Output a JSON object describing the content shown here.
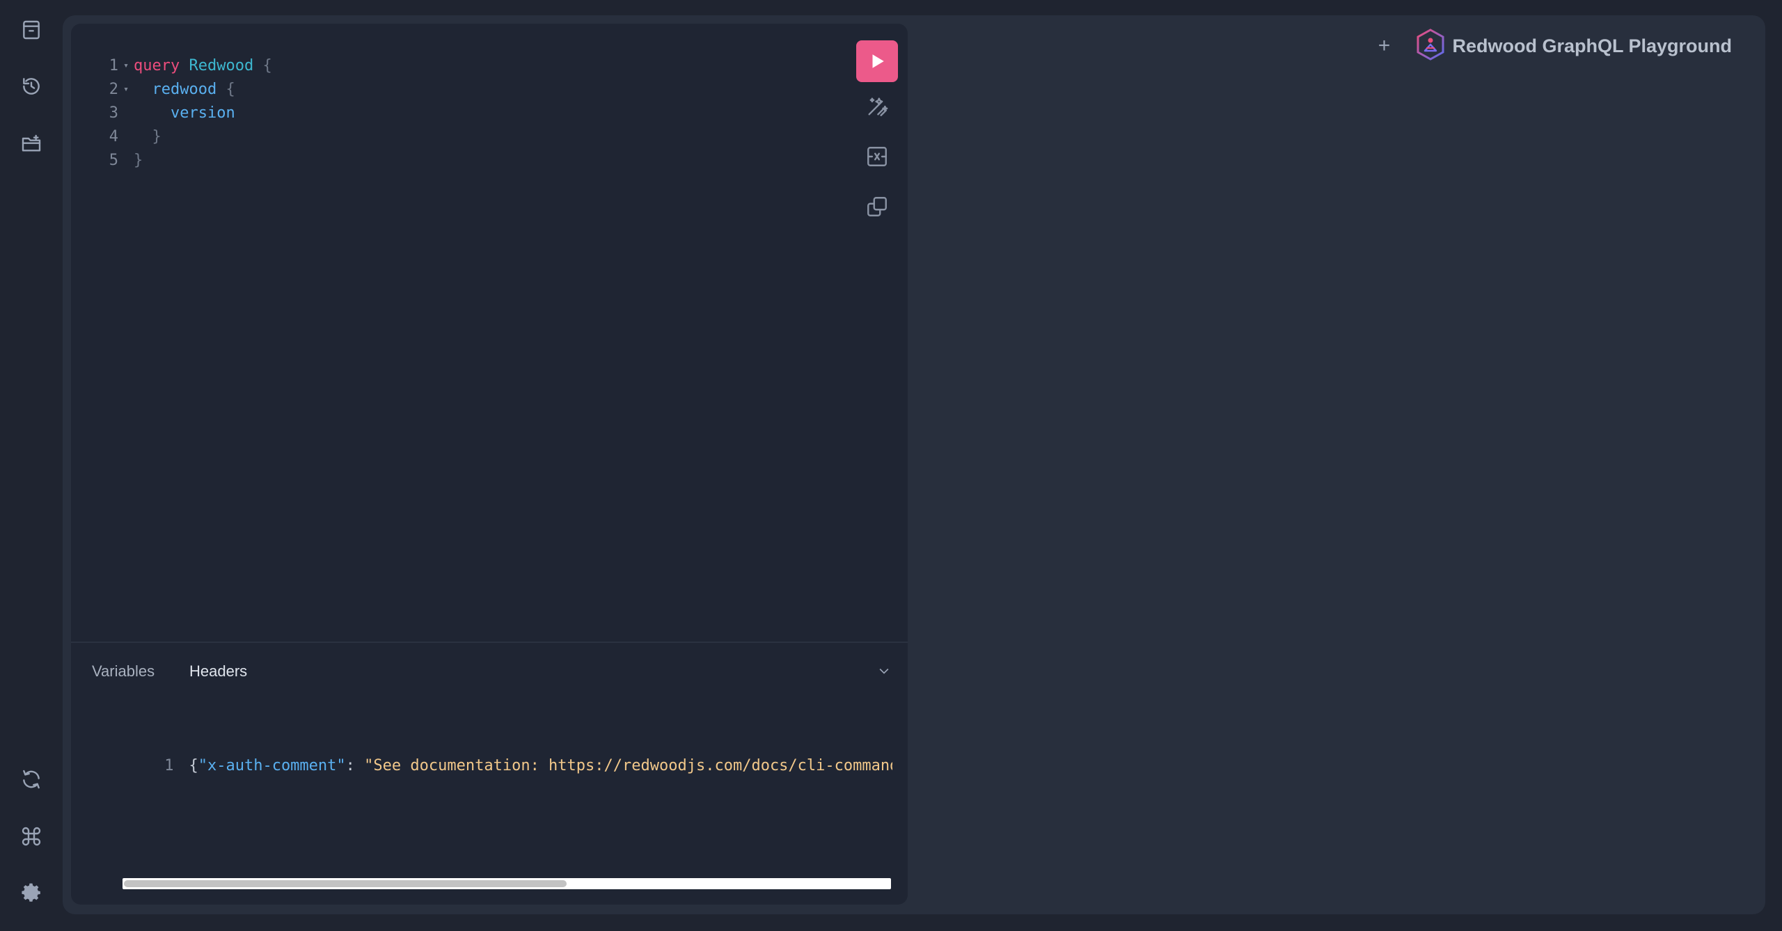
{
  "sidebar": {
    "top_items": [
      {
        "icon": "document-icon"
      },
      {
        "icon": "history-icon"
      },
      {
        "icon": "folder-icon"
      }
    ],
    "bottom_items": [
      {
        "icon": "refresh-icon"
      },
      {
        "icon": "command-icon"
      },
      {
        "icon": "settings-gear-icon"
      }
    ]
  },
  "header": {
    "add_tab_label": "+",
    "title": "Redwood GraphQL Playground"
  },
  "query_editor": {
    "lines": [
      {
        "n": "1",
        "fold": "▾"
      },
      {
        "n": "2",
        "fold": "▾"
      },
      {
        "n": "3",
        "fold": ""
      },
      {
        "n": "4",
        "fold": ""
      },
      {
        "n": "5",
        "fold": ""
      }
    ],
    "tokens": {
      "kw_query": "query",
      "op_name": "Redwood",
      "brace_open": "{",
      "field_redwood": "redwood",
      "field_version": "version",
      "brace_close": "}"
    }
  },
  "toolbar": {
    "run": "run-icon",
    "prettify": "prettify-icon",
    "merge": "merge-fragments-icon",
    "copy": "copy-icon"
  },
  "bottom_panel": {
    "tabs": [
      "Variables",
      "Headers"
    ],
    "active_tab": "Headers",
    "headers_line_number": "1",
    "headers_tokens": {
      "open": "{",
      "key": "\"x-auth-comment\"",
      "colon": ": ",
      "value": "\"See documentation: https://redwoodjs.com/docs/cli-commands#setup-graphql-playground\""
    }
  },
  "colors": {
    "accent": "#ec5a8a",
    "background": "#1f2430",
    "panel": "#282f3d",
    "editor": "#1f2533"
  }
}
